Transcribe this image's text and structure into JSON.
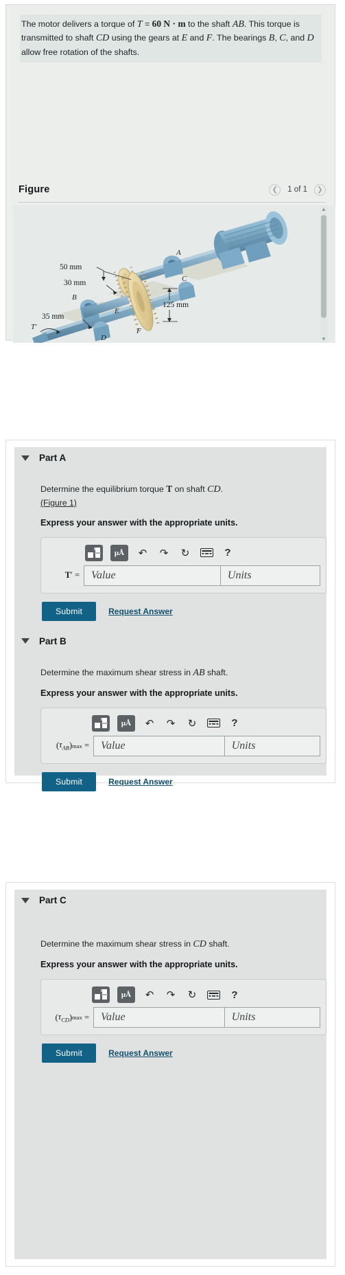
{
  "problem": {
    "text_parts": [
      "The motor delivers a torque of ",
      "T",
      " = ",
      "60 N · m",
      " to the shaft ",
      "AB",
      ". This torque is transmitted to shaft ",
      "CD",
      " using the gears at ",
      "E",
      " and ",
      "F",
      ". The bearings ",
      "B",
      ", ",
      "C",
      ", and ",
      "D",
      " allow free rotation of the shafts."
    ],
    "plain": "The motor delivers a torque of T = 60 N · m to the shaft AB. This torque is transmitted to shaft CD using the gears at E and F. The bearings B, C, and D allow free rotation of the shafts.",
    "torque_value": "60 N · m"
  },
  "figure": {
    "title": "Figure",
    "counter": "1 of 1",
    "prev_icon": "chevron-left-icon",
    "next_icon": "chevron-right-icon",
    "labels": {
      "dim_top": "50 mm",
      "dim_mid": "30 mm",
      "dim_bottom": "35 mm",
      "dim_right": "125 mm",
      "pt_a": "A",
      "pt_b": "B",
      "pt_c": "C",
      "pt_d": "D",
      "pt_e": "E",
      "pt_f": "F",
      "pt_t": "T"
    },
    "colors": {
      "shaft": "#7fa6bf",
      "shaft_dark": "#5f8aa6",
      "gear": "#e8d9a8",
      "gear_dark": "#cdb97f",
      "motor": "#88b2cc",
      "base": "#d8d6c6",
      "background": "#e6eae8"
    }
  },
  "parts": [
    {
      "id": "part-a",
      "label": "Part A",
      "caret_icon": "caret-down-icon",
      "question": "Determine the equilibrium torque ",
      "question_var": "T",
      "question_tail": " on shaft ",
      "question_shaft": "CD",
      "question_end": ".",
      "figure_link": "(Figure 1)",
      "instruction": "Express your answer with the appropriate units.",
      "symbol_html": "T' =",
      "value_placeholder": "Value",
      "units_placeholder": "Units",
      "submit_label": "Submit",
      "request_label": "Request Answer"
    },
    {
      "id": "part-b",
      "label": "Part B",
      "caret_icon": "caret-down-icon",
      "question": "Determine the maximum shear stress in ",
      "question_var": "",
      "question_tail": "",
      "question_shaft": "AB",
      "question_end": " shaft.",
      "figure_link": "",
      "instruction": "Express your answer with the appropriate units.",
      "symbol_html": "(τAB)max =",
      "value_placeholder": "Value",
      "units_placeholder": "Units",
      "submit_label": "Submit",
      "request_label": "Request Answer"
    },
    {
      "id": "part-c",
      "label": "Part C",
      "caret_icon": "caret-down-icon",
      "question": "Determine the maximum shear stress in ",
      "question_var": "",
      "question_tail": "",
      "question_shaft": "CD",
      "question_end": " shaft.",
      "figure_link": "",
      "instruction": "Express your answer with the appropriate units.",
      "symbol_html": "(τCD)max =",
      "value_placeholder": "Value",
      "units_placeholder": "Units",
      "submit_label": "Submit",
      "request_label": "Request Answer"
    }
  ],
  "toolbar": {
    "template_icon": "math-template-icon",
    "units_icon": "micro-angstrom-units-icon",
    "units_label": "μÅ",
    "undo_icon": "undo-arrow-icon",
    "redo_icon": "redo-arrow-icon",
    "reset_icon": "reset-circular-arrow-icon",
    "keyboard_icon": "keyboard-icon",
    "help_icon": "question-mark-icon",
    "help_label": "?"
  },
  "colors": {
    "submit_button": "#126186",
    "link": "#13506e",
    "card_background": "#e7eae8",
    "page_background": "#ffffff"
  }
}
